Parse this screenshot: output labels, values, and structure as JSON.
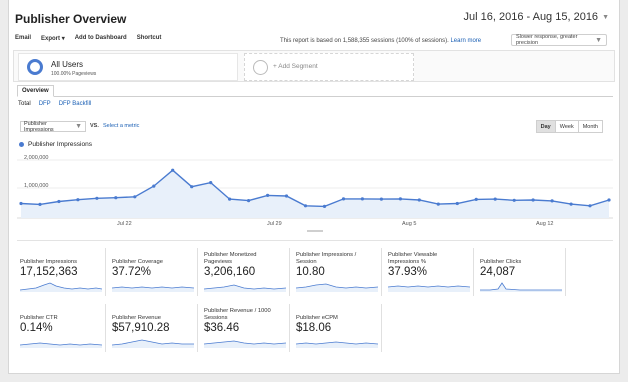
{
  "header": {
    "title": "Publisher Overview",
    "date_range": "Jul 16, 2016 - Aug 15, 2016"
  },
  "toolbar": {
    "items": [
      "Email",
      "Export",
      "Add to Dashboard",
      "Shortcut"
    ],
    "export_caret": "▾"
  },
  "report_note": {
    "text": "This report is based on 1,588,355 sessions (100% of sessions).",
    "link": "Learn more"
  },
  "precision": {
    "selected": "Slower response, greater precision"
  },
  "segments": {
    "active": {
      "name": "All Users",
      "sub": "100.00% Pageviews"
    },
    "add_label": "+ Add Segment"
  },
  "tabs": {
    "overview": "Overview"
  },
  "subtabs": {
    "total": "Total",
    "dfp": "DFP",
    "dfp_backfill": "DFP Backfill"
  },
  "metric_controls": {
    "selected_metric": "Publisher Impressions",
    "vs": "VS.",
    "select_metric": "Select a metric"
  },
  "granularity": {
    "options": [
      "Day",
      "Week",
      "Month"
    ],
    "selected": "Day"
  },
  "chart_data": {
    "type": "area",
    "series": [
      {
        "name": "Publisher Impressions",
        "values": [
          500000,
          470000,
          570000,
          630000,
          680000,
          700000,
          730000,
          1100000,
          1650000,
          1080000,
          1220000,
          650000,
          600000,
          780000,
          760000,
          420000,
          400000,
          660000,
          660000,
          650000,
          660000,
          620000,
          480000,
          500000,
          640000,
          650000,
          610000,
          620000,
          590000,
          480000,
          420000,
          620000
        ]
      }
    ],
    "x_labels": [
      "Jul 22",
      "Jul 29",
      "Aug 5",
      "Aug 12"
    ],
    "y_labels": [
      "2,000,000",
      "1,000,000"
    ],
    "ylim": [
      0,
      2000000
    ],
    "color": "#4a7bd0"
  },
  "metrics": [
    {
      "label": "Publisher Impressions",
      "value": "17,152,363"
    },
    {
      "label": "Publisher Coverage",
      "value": "37.72%"
    },
    {
      "label": "Publisher Monetized Pageviews",
      "value": "3,206,160"
    },
    {
      "label": "Publisher Impressions / Session",
      "value": "10.80"
    },
    {
      "label": "Publisher Viewable Impressions %",
      "value": "37.93%"
    },
    {
      "label": "Publisher Clicks",
      "value": "24,087"
    },
    {
      "label": "Publisher CTR",
      "value": "0.14%"
    },
    {
      "label": "Publisher Revenue",
      "value": "$57,910.28"
    },
    {
      "label": "Publisher Revenue / 1000 Sessions",
      "value": "$36.46"
    },
    {
      "label": "Publisher eCPM",
      "value": "$18.06"
    }
  ]
}
